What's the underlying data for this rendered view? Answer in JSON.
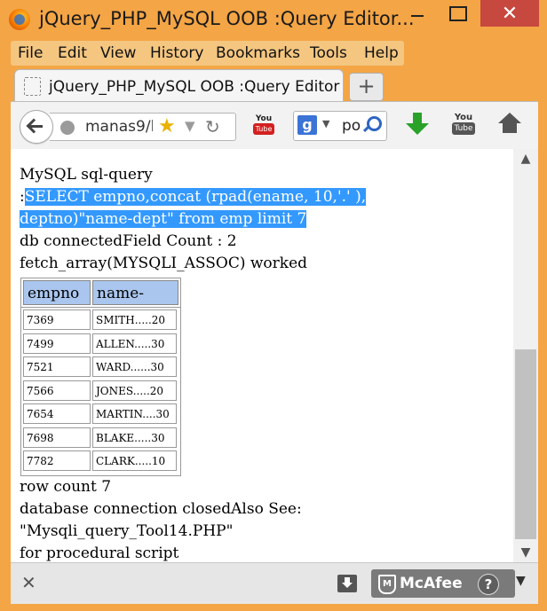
{
  "window": {
    "title": "jQuery_PHP_MySQL OOB :Query Editor...",
    "minimize_icon": "minimize-icon",
    "maximize_icon": "maximize-icon",
    "close_glyph": "✕"
  },
  "menu": {
    "items": [
      "File",
      "Edit",
      "View",
      "History",
      "Bookmarks",
      "Tools",
      "Help"
    ]
  },
  "tabs": [
    {
      "label": "jQuery_PHP_MySQL OOB :Query Editor"
    }
  ],
  "toolbar": {
    "new_tab": "+",
    "url": "manas9/l",
    "search_text": "po",
    "search_engine_letter": "g",
    "youtube_small_top": "You",
    "youtube_small_bottom": "Tube",
    "youtube_big_top": "You",
    "youtube_big_bottom": "Tube"
  },
  "content": {
    "line1": "MySQL sql-query",
    "query_prefix": ":",
    "query_line1": "SELECT empno,concat (rpad(ename, 10,'.' ),",
    "query_line2": "deptno)\"name-dept\" from emp limit 7",
    "line_db": "db connectedField Count : 2",
    "line_fetch": "fetch_array(MYSQLI_ASSOC) worked",
    "table": {
      "headers": [
        "empno",
        "name-dept"
      ],
      "rows": [
        [
          "7369",
          "SMITH.....20"
        ],
        [
          "7499",
          "ALLEN.....30"
        ],
        [
          "7521",
          "WARD......30"
        ],
        [
          "7566",
          "JONES.....20"
        ],
        [
          "7654",
          "MARTIN....30"
        ],
        [
          "7698",
          "BLAKE.....30"
        ],
        [
          "7782",
          "CLARK.....10"
        ]
      ]
    },
    "line_rowcount": "row count 7",
    "line_closed": "database connection closedAlso See:",
    "line_file": "\"Mysqli_query_Tool14.PHP\"",
    "line_proc": "for procedural script"
  },
  "statusbar": {
    "close_glyph": "✕",
    "mcafee_label": "McAfee",
    "mcafee_shield": "M",
    "help_glyph": "?",
    "dropdown_glyph": "▼"
  },
  "scrollbar": {
    "up_glyph": "▲",
    "down_glyph": "▼",
    "scroll_position": 0.82
  },
  "colors": {
    "window_frame": "#f4a545",
    "selection": "#3399ff",
    "table_header": "#aac6ee",
    "close_button": "#c7483f"
  }
}
